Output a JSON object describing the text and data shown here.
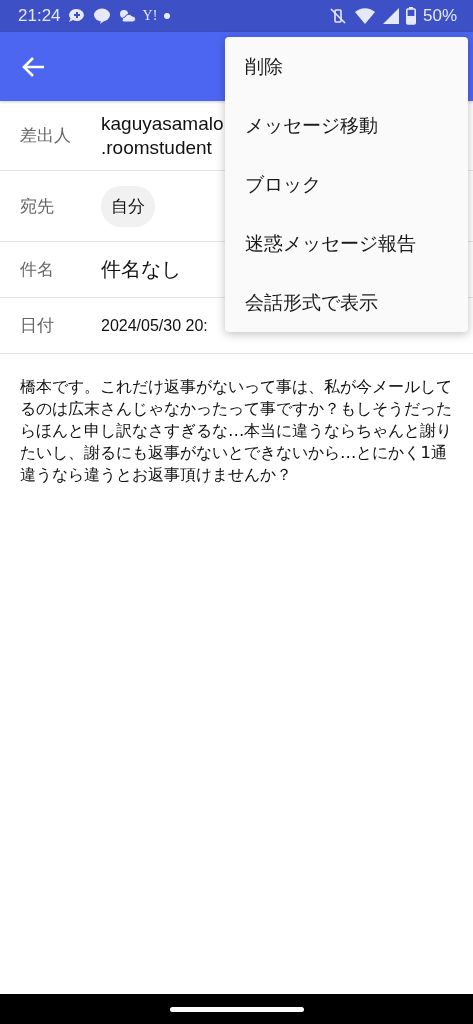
{
  "status_bar": {
    "time": "21:24",
    "yahoo": "Y!",
    "battery": "50%"
  },
  "fields": [
    {
      "label": "差出人",
      "kind": "lines",
      "lines": [
        "kaguyasamalo",
        ".roomstudent"
      ]
    },
    {
      "label": "宛先",
      "kind": "chip",
      "value": "自分"
    },
    {
      "label": "件名",
      "kind": "large",
      "value": "件名なし"
    },
    {
      "label": "日付",
      "kind": "small",
      "value": "2024/05/30 20:"
    }
  ],
  "body": "橋本です。これだけ返事がないって事は、私が今メールしてるのは広末さんじゃなかったって事ですか？もしそうだったらほんと申し訳なさすぎるな…本当に違うならちゃんと謝りたいし、謝るにも返事がないとできないから…とにかく1通違うなら違うとお返事頂けませんか？",
  "menu": [
    "削除",
    "メッセージ移動",
    "ブロック",
    "迷惑メッセージ報告",
    "会話形式で表示"
  ]
}
